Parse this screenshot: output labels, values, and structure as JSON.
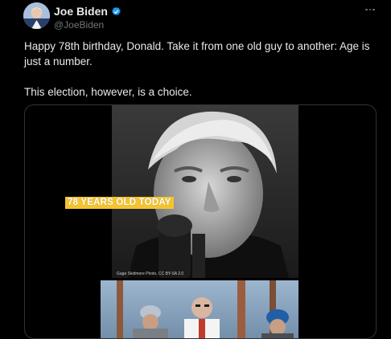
{
  "author": {
    "name": "Joe Biden",
    "handle": "@JoeBiden",
    "verified_icon": "verified-badge-icon",
    "verified_color": "#1d9bf0"
  },
  "post": {
    "paragraph1": "Happy 78th birthday, Donald. Take it from one old guy to another: Age is just a number.",
    "paragraph2": "This election, however, is a choice."
  },
  "media": {
    "overlay_text": "78 YEARS OLD TODAY",
    "overlay_color": "#f4c430",
    "photo_credit": "Gage Skidmore Photo, CC BY-SA 2.0"
  },
  "more_icon": "more-horizontal-icon",
  "colors": {
    "background": "#000000",
    "text": "#e7e9ea",
    "secondary": "#71767b",
    "border": "#2f3336"
  }
}
